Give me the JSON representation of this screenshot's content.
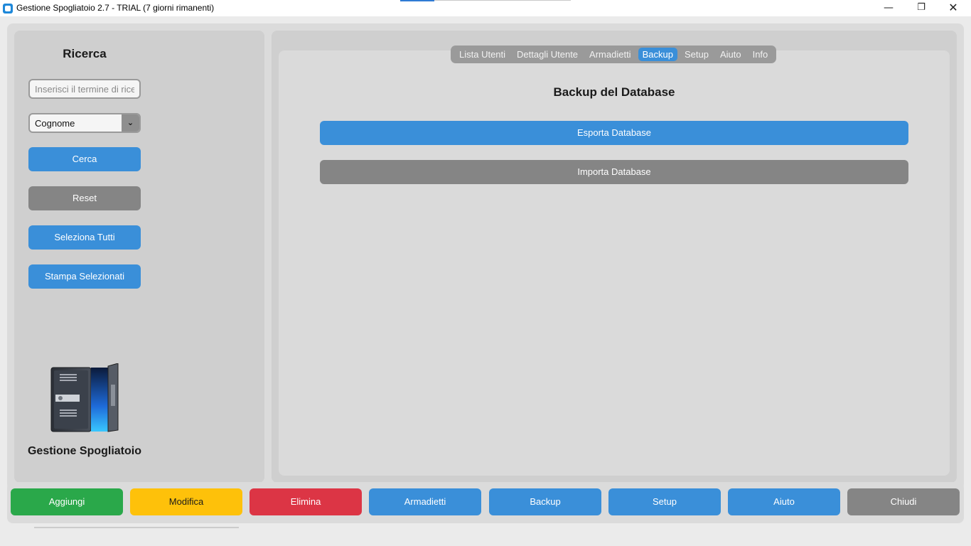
{
  "window": {
    "title": "Gestione Spogliatoio 2.7 - TRIAL (7 giorni rimanenti)",
    "controls": {
      "minimize": "—",
      "maximize": "❐",
      "close": "✕"
    }
  },
  "sidebar": {
    "title": "Ricerca",
    "search_placeholder": "Inserisci il termine di ricerca",
    "search_value": "",
    "field_select": {
      "selected": "Cognome",
      "arrow": "⌄"
    },
    "buttons": {
      "search": "Cerca",
      "reset": "Reset",
      "select_all": "Seleziona Tutti",
      "print_selected": "Stampa Selezionati"
    },
    "logo_icon": "locker-icon",
    "footer": "Gestione Spogliatoio"
  },
  "tabs": [
    {
      "label": "Lista Utenti",
      "active": false
    },
    {
      "label": "Dettagli Utente",
      "active": false
    },
    {
      "label": "Armadietti",
      "active": false
    },
    {
      "label": "Backup",
      "active": true
    },
    {
      "label": "Setup",
      "active": false
    },
    {
      "label": "Aiuto",
      "active": false
    },
    {
      "label": "Info",
      "active": false
    }
  ],
  "backup": {
    "title": "Backup del Database",
    "export_label": "Esporta Database",
    "import_label": "Importa Database"
  },
  "bottom_bar": [
    {
      "label": "Aggiungi",
      "color": "#2aa84a"
    },
    {
      "label": "Modifica",
      "color": "#fec10a"
    },
    {
      "label": "Elimina",
      "color": "#dc3545"
    },
    {
      "label": "Armadietti",
      "color": "#3a8fd9"
    },
    {
      "label": "Backup",
      "color": "#3a8fd9"
    },
    {
      "label": "Setup",
      "color": "#3a8fd9"
    },
    {
      "label": "Aiuto",
      "color": "#3a8fd9"
    },
    {
      "label": "Chiudi",
      "color": "#858585"
    }
  ],
  "colors": {
    "primary": "#3a8fd9",
    "secondary": "#858585",
    "panel": "#cfcfcf"
  }
}
